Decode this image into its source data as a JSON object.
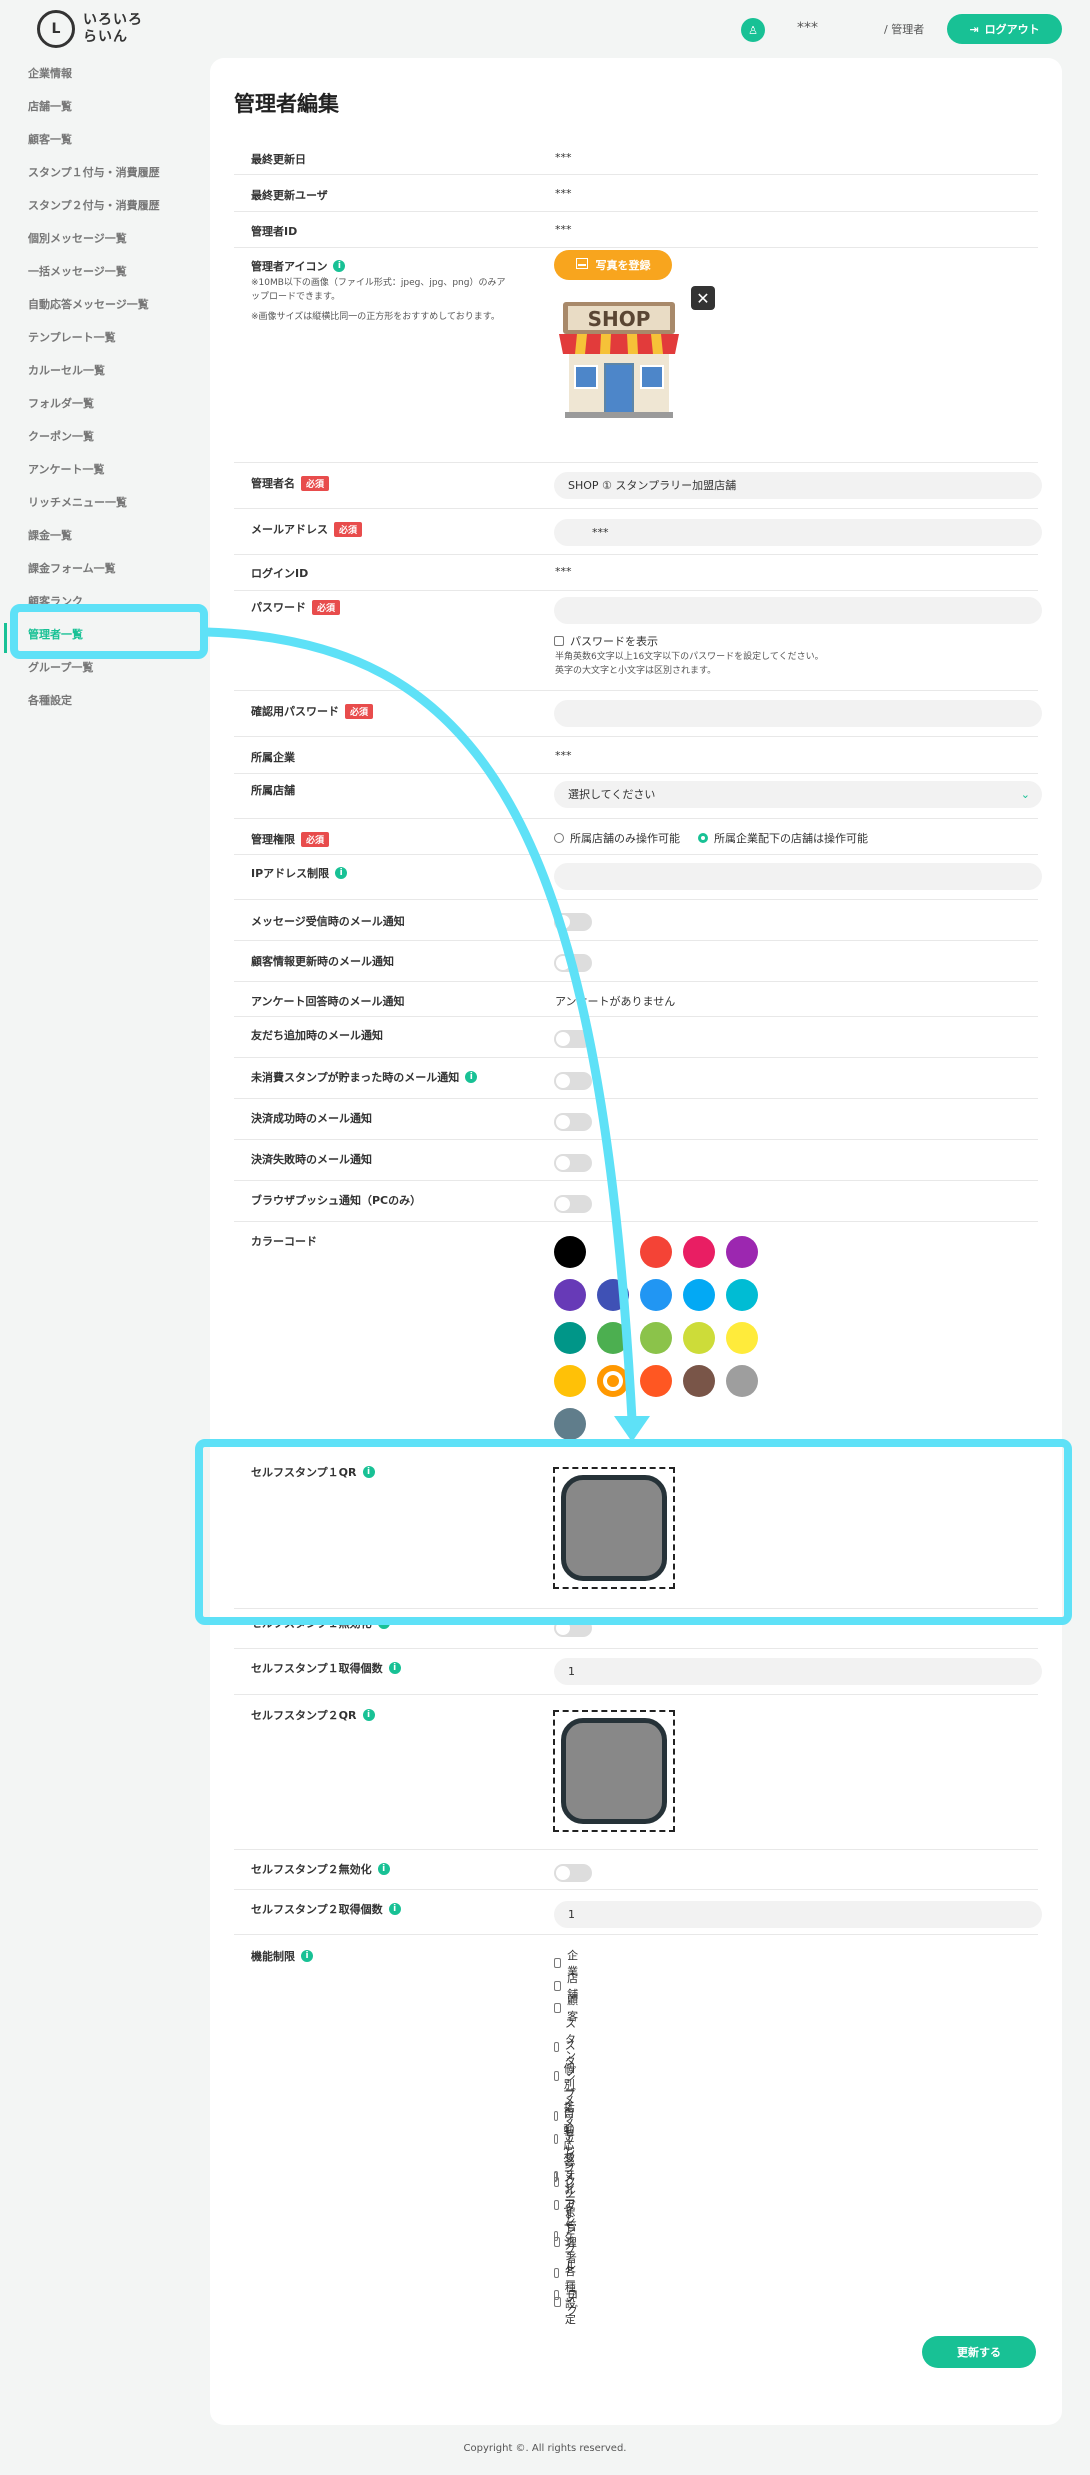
{
  "header": {
    "logo_mark": "L",
    "logo_line1": "いろいろ",
    "logo_line2": "らいん",
    "avatar_glyph": "♙",
    "user_name": "***",
    "role": "/ 管理者",
    "logout_label": "ログアウト",
    "logout_glyph": "⇥"
  },
  "sidebar": {
    "items": [
      {
        "label": "企業情報"
      },
      {
        "label": "店舗一覧"
      },
      {
        "label": "顧客一覧"
      },
      {
        "label": "スタンプ１付与・消費履歴"
      },
      {
        "label": "スタンプ２付与・消費履歴"
      },
      {
        "label": "個別メッセージ一覧"
      },
      {
        "label": "一括メッセージ一覧"
      },
      {
        "label": "自動応答メッセージ一覧"
      },
      {
        "label": "テンプレート一覧"
      },
      {
        "label": "カルーセル一覧"
      },
      {
        "label": "フォルダ一覧"
      },
      {
        "label": "クーポン一覧"
      },
      {
        "label": "アンケート一覧"
      },
      {
        "label": "リッチメニュー一覧"
      },
      {
        "label": "課金一覧"
      },
      {
        "label": "課金フォーム一覧"
      },
      {
        "label": "顧客ランク"
      },
      {
        "label": "管理者一覧"
      },
      {
        "label": "グループ一覧"
      },
      {
        "label": "各種設定"
      }
    ]
  },
  "main": {
    "title": "管理者編集",
    "required_badge": "必須",
    "info_glyph": "i",
    "last_updated_label": "最終更新日",
    "last_updated_value": "***",
    "last_user_label": "最終更新ユーザ",
    "last_user_value": "***",
    "admin_id_label": "管理者ID",
    "admin_id_value": "***",
    "icon_label": "管理者アイコン",
    "icon_note1": "※10MB以下の画像（ファイル形式：jpeg、jpg、png）のみアップロードできます。",
    "icon_note2": "※画像サイズは縦横比同一の正方形をおすすめしております。",
    "upload_label": "写真を登録",
    "shop_sign": "SHOP",
    "remove_glyph": "✕",
    "name_label": "管理者名",
    "name_value": "SHOP ① スタンプラリー加盟店舗",
    "email_label": "メールアドレス",
    "email_value": "***",
    "login_id_label": "ログインID",
    "login_id_value": "***",
    "password_label": "パスワード",
    "password_value": "",
    "show_password_label": "パスワードを表示",
    "password_note1": "半角英数6文字以上16文字以下のパスワードを設定してください。",
    "password_note2": "英字の大文字と小文字は区別されます。",
    "confirm_password_label": "確認用パスワード",
    "confirm_password_value": "",
    "company_label": "所属企業",
    "company_value": "***",
    "store_label": "所属店舗",
    "store_placeholder": "選択してください",
    "permission_label": "管理権限",
    "permission_option1": "所属店舗のみ操作可能",
    "permission_option2": "所属企業配下の店舗は操作可能",
    "ip_label": "IPアドレス制限",
    "ip_value": "",
    "notify_message_label": "メッセージ受信時のメール通知",
    "notify_customer_label": "顧客情報更新時のメール通知",
    "notify_survey_label": "アンケート回答時のメール通知",
    "notify_survey_value": "アンケートがありません",
    "notify_friend_label": "友だち追加時のメール通知",
    "notify_stamp_label": "未消費スタンプが貯まった時のメール通知",
    "notify_pay_ok_label": "決済成功時のメール通知",
    "notify_pay_ng_label": "決済失敗時のメール通知",
    "notify_push_label": "ブラウザプッシュ通知（PCのみ）",
    "color_label": "カラーコード",
    "colors": [
      "#000000",
      "#ffffff",
      "#f44336",
      "#e91e63",
      "#9c27b0",
      "#673ab7",
      "#3f51b5",
      "#2196f3",
      "#03a9f4",
      "#00bcd4",
      "#009688",
      "#4caf50",
      "#8bc34a",
      "#cddc39",
      "#ffeb3b",
      "#ffc107",
      "#ff9800",
      "#ff5722",
      "#795548",
      "#9e9e9e",
      "#607d8b"
    ],
    "selected_color": "#ff9800",
    "qr1_label": "セルフスタンプ１QR",
    "stamp1_disable_label": "セルフスタンプ１無効化",
    "stamp1_count_label": "セルフスタンプ１取得個数",
    "stamp1_count_value": "1",
    "qr2_label": "セルフスタンプ２QR",
    "stamp2_disable_label": "セルフスタンプ２無効化",
    "stamp2_count_label": "セルフスタンプ２取得個数",
    "stamp2_count_value": "1",
    "features_label": "機能制限",
    "features": [
      "企業",
      "店舗",
      "顧客",
      "スタンプ",
      "スタンプ2",
      "個別メッセージ",
      "一括メッセージ",
      "自動応答メッセージ",
      "テンプレート",
      "フォルダ",
      "クーポン",
      "アンケート",
      "管理者",
      "グループ",
      "各種設定",
      "ログ"
    ],
    "submit_label": "更新する"
  },
  "footer": {
    "copyright": "Copyright ©. All rights reserved."
  }
}
